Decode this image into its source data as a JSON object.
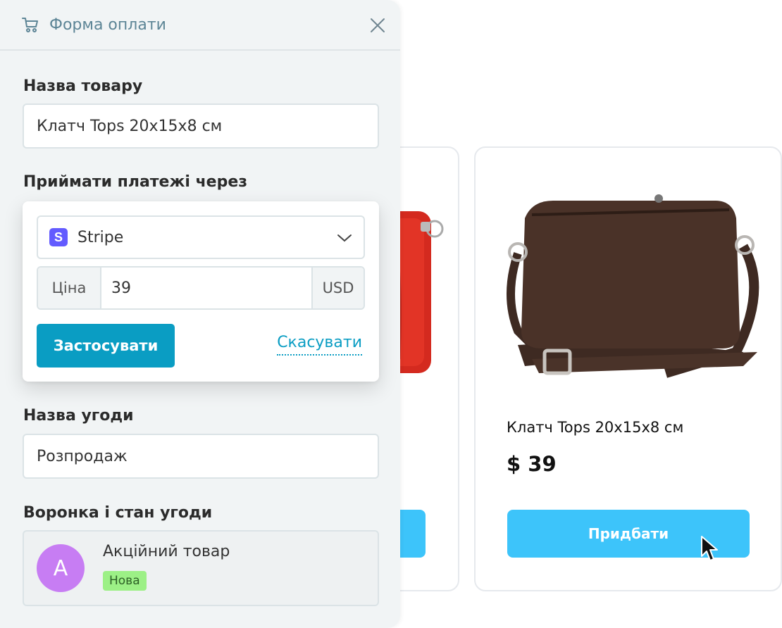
{
  "form": {
    "title": "Форма оплати",
    "product_label": "Назва товару",
    "product_value": "Клатч Tops 20x15x8 см",
    "accept_label": "Приймати платежі через",
    "deal_name_label": "Назва угоди",
    "deal_name_value": "Розпродаж",
    "pipeline_label": "Воронка і стан угоди"
  },
  "payment_popover": {
    "provider": "Stripe",
    "provider_icon_letter": "S",
    "price_label": "Ціна",
    "price_value": "39",
    "currency": "USD",
    "apply_label": "Застосувати",
    "cancel_label": "Скасувати"
  },
  "deal": {
    "avatar_letter": "A",
    "name": "Акційний товар",
    "stage": "Нова"
  },
  "product_card": {
    "name": "Клатч Tops 20x15x8 см",
    "price": "$ 39",
    "buy_label": "Придбати"
  },
  "colors": {
    "accent": "#0a9dc3",
    "buy_button": "#3dc4fa",
    "stripe": "#635bff",
    "avatar": "#c77df3",
    "badge": "#9cf086"
  }
}
